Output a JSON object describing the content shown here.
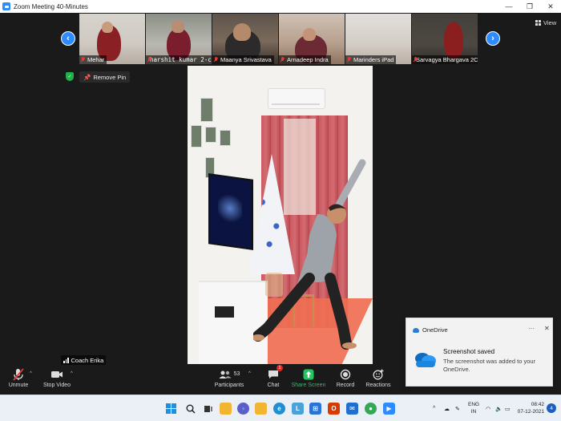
{
  "window": {
    "title": "Zoom Meeting 40-Minutes",
    "controls": [
      "—",
      "❐",
      "✕"
    ]
  },
  "gallery": {
    "participants": [
      {
        "name": "Mehar"
      },
      {
        "name": "harshit kumar 2-c"
      },
      {
        "name": "Maanya Srivastava"
      },
      {
        "name": "Arnadeep Indra"
      },
      {
        "name": "Marinders iPad"
      },
      {
        "name": "Sarvagya Bhargava 2C"
      }
    ],
    "view_label": "View"
  },
  "pin": {
    "remove_label": "Remove Pin"
  },
  "speaker": {
    "name": "Coach Erika"
  },
  "toolbar": {
    "unmute": "Unmute",
    "stop_video": "Stop Video",
    "participants": "Participants",
    "participants_count": "53",
    "chat": "Chat",
    "chat_badge": "1",
    "share_screen": "Share Screen",
    "record": "Record",
    "reactions": "Reactions"
  },
  "toast": {
    "app": "OneDrive",
    "heading": "Screenshot saved",
    "body": "The screenshot was added to your OneDrive.",
    "more": "···",
    "close": "✕"
  },
  "taskbar": {
    "lang_top": "ENG",
    "lang_bottom": "IN",
    "time": "08:42",
    "date": "07-12-2021",
    "notification_count": "4",
    "apps": [
      {
        "icon": "windows-start-icon",
        "color": "#1f6fd1"
      },
      {
        "icon": "search-icon",
        "color": "#222222"
      },
      {
        "icon": "task-view-icon",
        "color": "#333333"
      },
      {
        "icon": "file-explorer-icon",
        "color": "#f2b531"
      },
      {
        "icon": "teams-icon",
        "color": "#5b5fc7"
      },
      {
        "icon": "file-manager-icon",
        "color": "#f2b531"
      },
      {
        "icon": "edge-icon",
        "color": "#1f8fd1"
      },
      {
        "icon": "lenovo-vantage-icon",
        "color": "#4aa3d8"
      },
      {
        "icon": "store-icon",
        "color": "#2a72d6"
      },
      {
        "icon": "office-icon",
        "color": "#d83b01"
      },
      {
        "icon": "mail-icon",
        "color": "#1f6fd1"
      },
      {
        "icon": "chrome-icon",
        "color": "#34a853"
      },
      {
        "icon": "zoom-icon",
        "color": "#2d8cff"
      }
    ]
  },
  "colors": {
    "zoom_blue": "#2d8cff",
    "muted_red": "#e03b3b",
    "share_green": "#22c55e",
    "toolbar_bg": "#1a1a1a"
  }
}
